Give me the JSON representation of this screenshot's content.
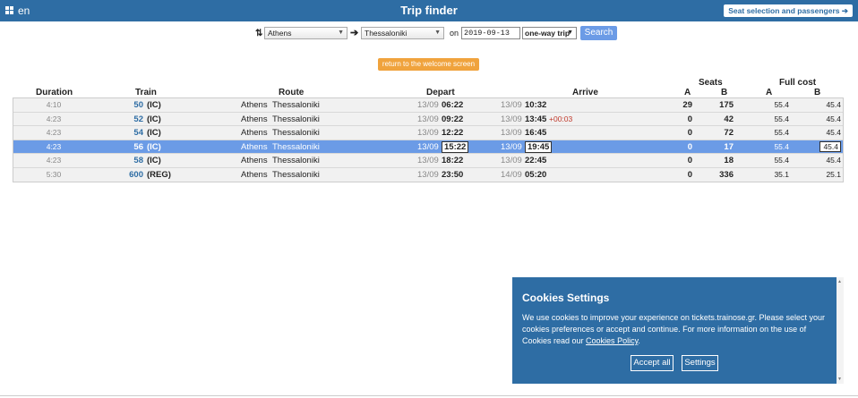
{
  "header": {
    "icon": "grid-icon",
    "lang": "en",
    "title": "Trip finder",
    "seat_button": "Seat selection and passengers ➔"
  },
  "search": {
    "from": "Athens",
    "to": "Thessaloniki",
    "on_label": "on",
    "date": "2019-09-13",
    "trip_type": "one-way trip",
    "search_button": "Search"
  },
  "welcome_button": "return to the welcome screen",
  "columns": {
    "duration": "Duration",
    "train": "Train",
    "route": "Route",
    "depart": "Depart",
    "arrive": "Arrive",
    "seats": "Seats",
    "full_cost": "Full cost",
    "seats_a": "A",
    "seats_b": "B",
    "cost_a": "A",
    "cost_b": "B"
  },
  "rows": [
    {
      "duration": "4:10",
      "number": "50",
      "cls": "(IC)",
      "from": "Athens",
      "to": "Thessaloniki",
      "dep_date": "13/09",
      "dep_time": "06:22",
      "arr_date": "13/09",
      "arr_time": "10:32",
      "delay": "",
      "seats_a": "29",
      "seats_b": "175",
      "cost_a": "55.4",
      "cost_b": "45.4"
    },
    {
      "duration": "4:23",
      "number": "52",
      "cls": "(IC)",
      "from": "Athens",
      "to": "Thessaloniki",
      "dep_date": "13/09",
      "dep_time": "09:22",
      "arr_date": "13/09",
      "arr_time": "13:45",
      "delay": "+00:03",
      "seats_a": "0",
      "seats_b": "42",
      "cost_a": "55.4",
      "cost_b": "45.4"
    },
    {
      "duration": "4:23",
      "number": "54",
      "cls": "(IC)",
      "from": "Athens",
      "to": "Thessaloniki",
      "dep_date": "13/09",
      "dep_time": "12:22",
      "arr_date": "13/09",
      "arr_time": "16:45",
      "delay": "",
      "seats_a": "0",
      "seats_b": "72",
      "cost_a": "55.4",
      "cost_b": "45.4"
    },
    {
      "duration": "4:23",
      "number": "56",
      "cls": "(IC)",
      "from": "Athens",
      "to": "Thessaloniki",
      "dep_date": "13/09",
      "dep_time": "15:22",
      "arr_date": "13/09",
      "arr_time": "19:45",
      "delay": "",
      "seats_a": "0",
      "seats_b": "17",
      "cost_a": "55.4",
      "cost_b": "45.4"
    },
    {
      "duration": "4:23",
      "number": "58",
      "cls": "(IC)",
      "from": "Athens",
      "to": "Thessaloniki",
      "dep_date": "13/09",
      "dep_time": "18:22",
      "arr_date": "13/09",
      "arr_time": "22:45",
      "delay": "",
      "seats_a": "0",
      "seats_b": "18",
      "cost_a": "55.4",
      "cost_b": "45.4"
    },
    {
      "duration": "5:30",
      "number": "600",
      "cls": "(REG)",
      "from": "Athens",
      "to": "Thessaloniki",
      "dep_date": "13/09",
      "dep_time": "23:50",
      "arr_date": "14/09",
      "arr_time": "05:20",
      "delay": "",
      "seats_a": "0",
      "seats_b": "336",
      "cost_a": "35.1",
      "cost_b": "25.1"
    }
  ],
  "selected_row": 3,
  "cookies": {
    "title": "Cookies Settings",
    "text": "We use cookies to improve your experience on tickets.trainose.gr. Please select your cookies preferences or accept and continue. For more information on the use of Cookies read our ",
    "link": "Cookies Policy",
    "after_link": ".",
    "accept": "Accept all",
    "settings": "Settings"
  },
  "colors": {
    "header_bg": "#2e6da4",
    "selected_row": "#6b9be6",
    "welcome_btn": "#f0a33d"
  }
}
